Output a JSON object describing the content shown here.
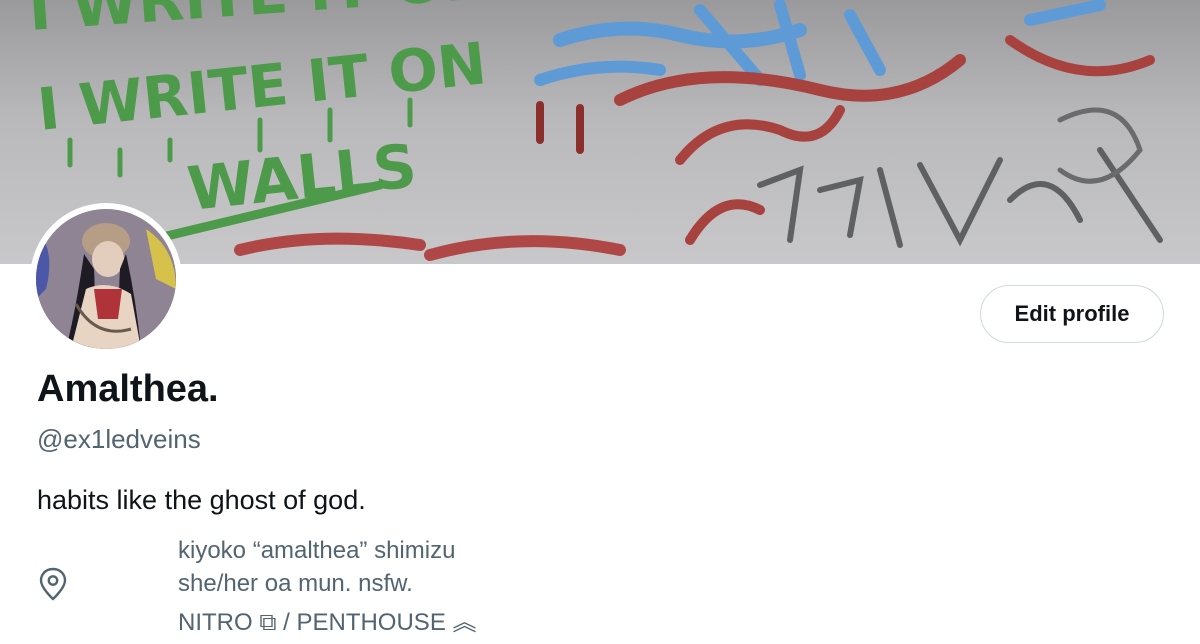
{
  "profile": {
    "display_name": "Amalthea.",
    "handle": "@ex1ledveins",
    "bio": "habits like the ghost of god.",
    "location_lines": [
      "kiyoko “amalthea” shimizu",
      "she/her      oa mun.  nsfw.",
      "NITRO ⧉ / PENTHOUSE ︽"
    ]
  },
  "actions": {
    "edit_profile_label": "Edit profile"
  },
  "banner": {
    "graffiti_text": [
      "I WRITE IT ON",
      "WALLS",
      "FUKING"
    ]
  },
  "icons": {
    "location": "location-pin-icon",
    "avatar": "avatar-illustration"
  },
  "colors": {
    "text_primary": "#0f1419",
    "text_secondary": "#536471",
    "button_border": "#cfd9de",
    "graffiti_green": "#4e9a4b",
    "graffiti_red": "#a8423f",
    "graffiti_blue": "#5e9bd6",
    "graffiti_dark": "#5f6062"
  }
}
